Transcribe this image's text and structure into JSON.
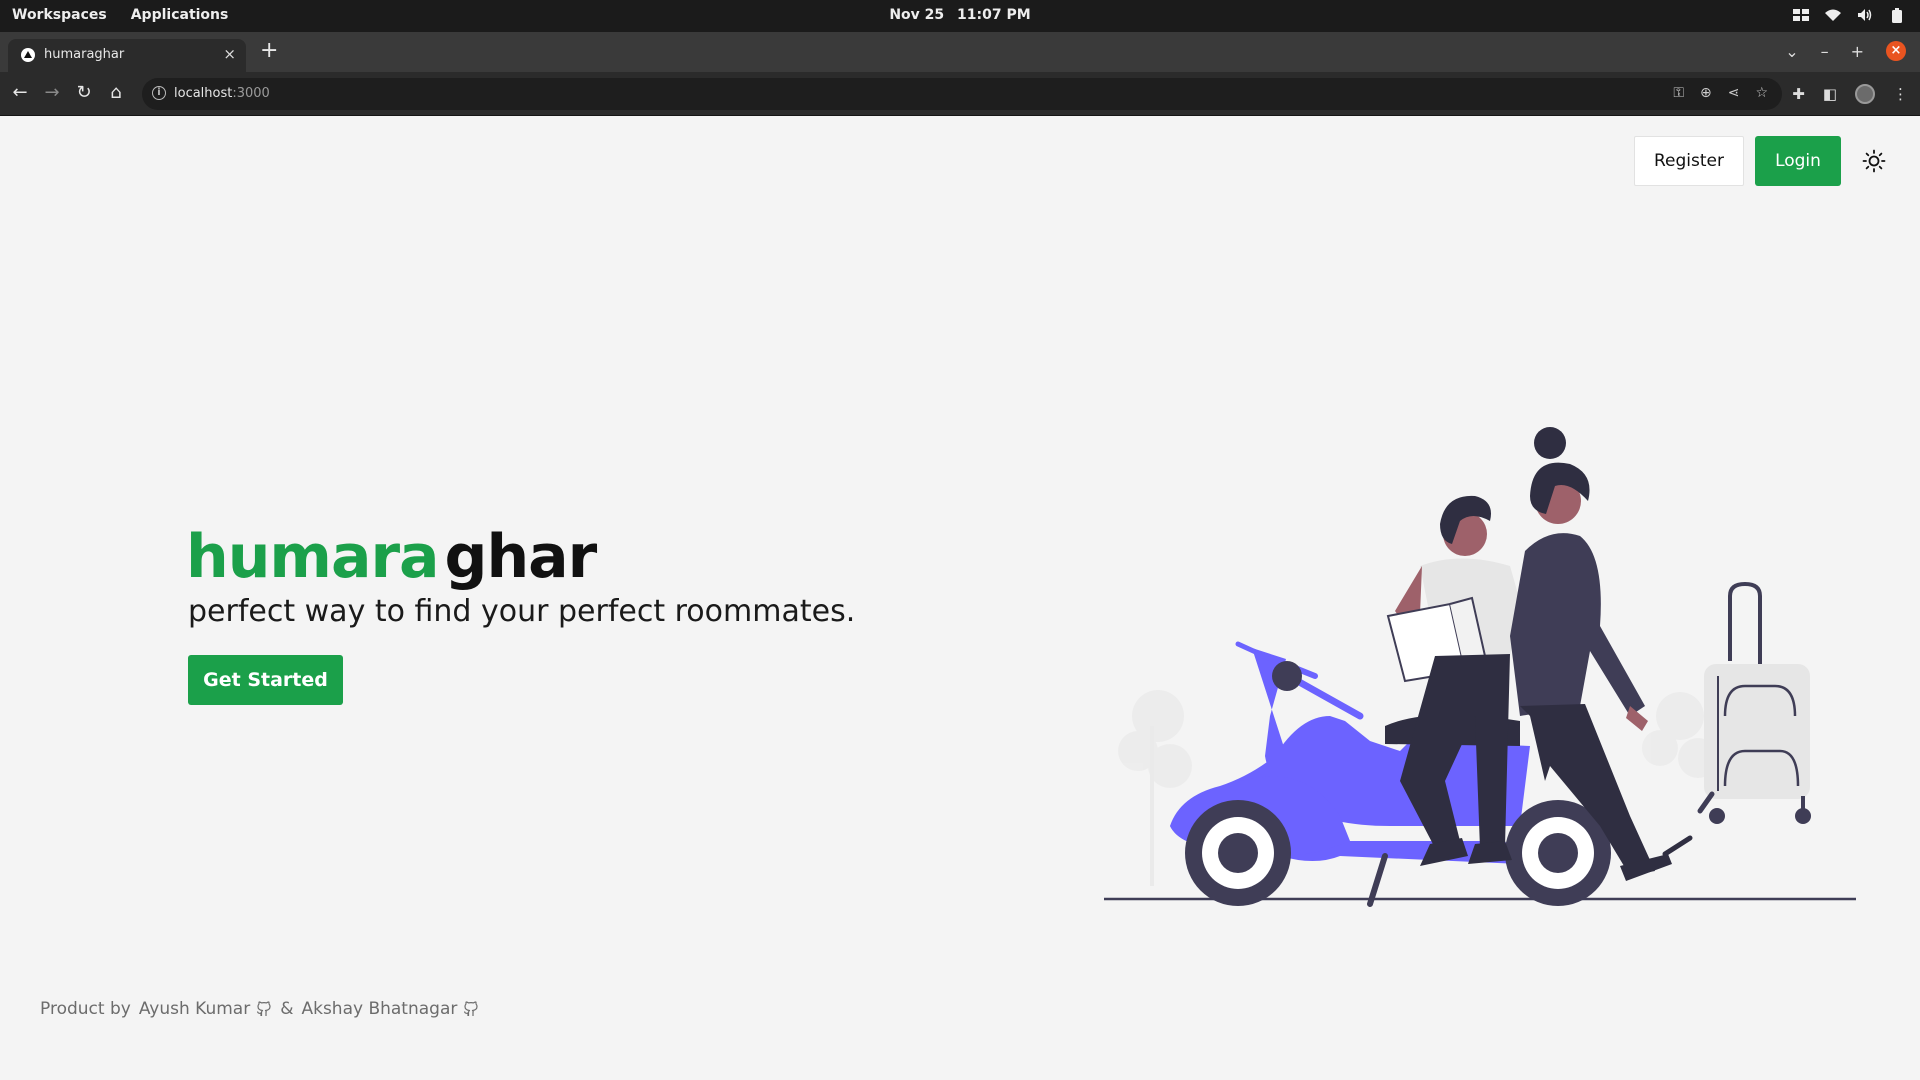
{
  "os_bar": {
    "workspaces": "Workspaces",
    "applications": "Applications",
    "date": "Nov 25",
    "time": "11:07 PM"
  },
  "browser": {
    "tab_title": "humaraghar",
    "url_host": "localhost",
    "url_port": ":3000"
  },
  "header": {
    "register_label": "Register",
    "login_label": "Login",
    "theme_icon": "sun-icon"
  },
  "hero": {
    "brand_part1": "humara",
    "brand_part2": "ghar",
    "tagline": "perfect way to find your perfect roommates.",
    "cta_label": "Get Started"
  },
  "footer": {
    "product_by": "Product by",
    "author1": "Ayush Kumar",
    "separator": "&",
    "author2": "Akshay Bhatnagar"
  },
  "colors": {
    "brand_green": "#1ba04a",
    "scooter_purple": "#6c63ff",
    "background": "#f4f4f4"
  }
}
